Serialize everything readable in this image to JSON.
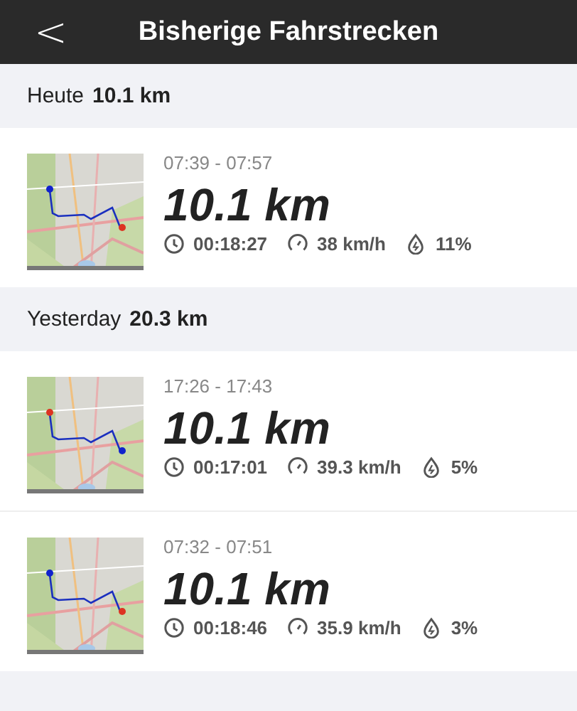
{
  "header": {
    "back": "<",
    "title": "Bisherige Fahrstrecken"
  },
  "sections": [
    {
      "day": "Heute",
      "total": "10.1 km",
      "trips": [
        {
          "time": "07:39 - 07:57",
          "distance": "10.1 km",
          "duration": "00:18:27",
          "speed": "38 km/h",
          "battery": "11%"
        }
      ]
    },
    {
      "day": "Yesterday",
      "total": "20.3 km",
      "trips": [
        {
          "time": "17:26 - 17:43",
          "distance": "10.1 km",
          "duration": "00:17:01",
          "speed": "39.3 km/h",
          "battery": "5%"
        },
        {
          "time": "07:32 - 07:51",
          "distance": "10.1 km",
          "duration": "00:18:46",
          "speed": "35.9 km/h",
          "battery": "3%"
        }
      ]
    }
  ]
}
